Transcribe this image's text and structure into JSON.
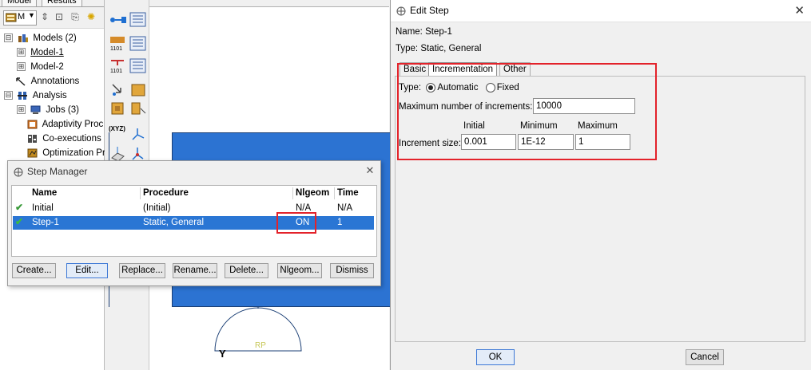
{
  "model_tree": {
    "tabs": [
      "Model",
      "Results"
    ],
    "combo_value": "M",
    "items": [
      {
        "label": "Models (2)",
        "expander": "⊟"
      },
      {
        "label": "Model-1",
        "expander": "⊞"
      },
      {
        "label": "Model-2",
        "expander": "⊞"
      },
      {
        "label": "Annotations",
        "expander": ""
      },
      {
        "label": "Analysis",
        "expander": "⊟"
      },
      {
        "label": "Jobs (3)",
        "expander": "⊞"
      },
      {
        "label": "Adaptivity Proc",
        "expander": ""
      },
      {
        "label": "Co-executions",
        "expander": ""
      },
      {
        "label": "Optimization Pr",
        "expander": ""
      }
    ]
  },
  "toolbox": {
    "labels": [
      "(XYZ)"
    ]
  },
  "viewport": {
    "rp_label": "RP",
    "axis_label": "Y"
  },
  "step_manager": {
    "title": "Step Manager",
    "columns": [
      "Name",
      "Procedure",
      "Nlgeom",
      "Time"
    ],
    "rows": [
      {
        "name": "Initial",
        "procedure": "(Initial)",
        "nlgeom": "N/A",
        "time": "N/A",
        "selected": false
      },
      {
        "name": "Step-1",
        "procedure": "Static, General",
        "nlgeom": "ON",
        "time": "1",
        "selected": true
      }
    ],
    "buttons": [
      "Create...",
      "Edit...",
      "Replace...",
      "Rename...",
      "Delete...",
      "Nlgeom...",
      "Dismiss"
    ]
  },
  "edit_step": {
    "title": "Edit Step",
    "name_line": "Name:  Step-1",
    "type_line": "Type:  Static, General",
    "tabs": [
      "Basic",
      "Incrementation",
      "Other"
    ],
    "active_tab": "Incrementation",
    "incr_type_label": "Type:",
    "incr_type_options": [
      "Automatic",
      "Fixed"
    ],
    "incr_type_selected": "Automatic",
    "max_increments_label": "Maximum number of increments:",
    "max_increments_value": "10000",
    "col_headers": [
      "Initial",
      "Minimum",
      "Maximum"
    ],
    "increment_size_label": "Increment size:",
    "increment_values": [
      "0.001",
      "1E-12",
      "1"
    ],
    "ok_label": "OK",
    "cancel_label": "Cancel"
  },
  "colors": {
    "selection": "#2a76d4",
    "highlight": "#e3222a",
    "part": "#2c73d2"
  }
}
